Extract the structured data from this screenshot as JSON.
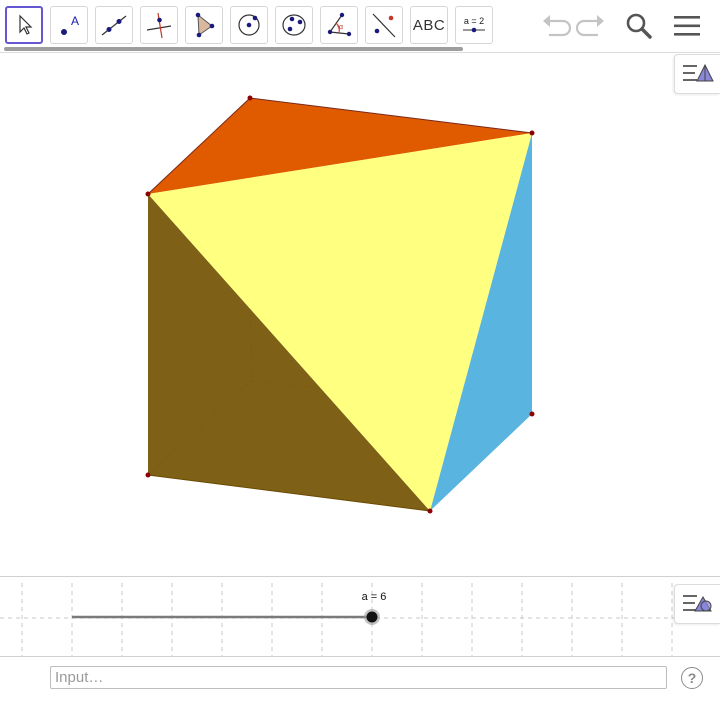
{
  "toolbar": {
    "tools": [
      {
        "name": "move-tool",
        "selected": true
      },
      {
        "name": "point-tool"
      },
      {
        "name": "line-tool"
      },
      {
        "name": "perpendicular-line-tool"
      },
      {
        "name": "polygon-tool"
      },
      {
        "name": "circle-tool"
      },
      {
        "name": "conic-tool"
      },
      {
        "name": "angle-tool"
      },
      {
        "name": "reflect-tool"
      },
      {
        "name": "text-tool",
        "label": "ABC"
      },
      {
        "name": "slider-tool",
        "label": "a = 2"
      }
    ],
    "actions": [
      "undo-icon",
      "redo-icon",
      "search-icon",
      "menu-icon"
    ]
  },
  "colors": {
    "accent": "#6557d2",
    "top_face": "#e05a00",
    "left_face": "#7a5c10",
    "right_face": "#5ab4e0",
    "front_face": "#ffff80",
    "vertex": "#8b0000"
  },
  "graphics": {
    "slider_label": "a = 6",
    "slider_value": 6
  },
  "input_bar": {
    "placeholder": "Input…",
    "help_label": "?"
  }
}
